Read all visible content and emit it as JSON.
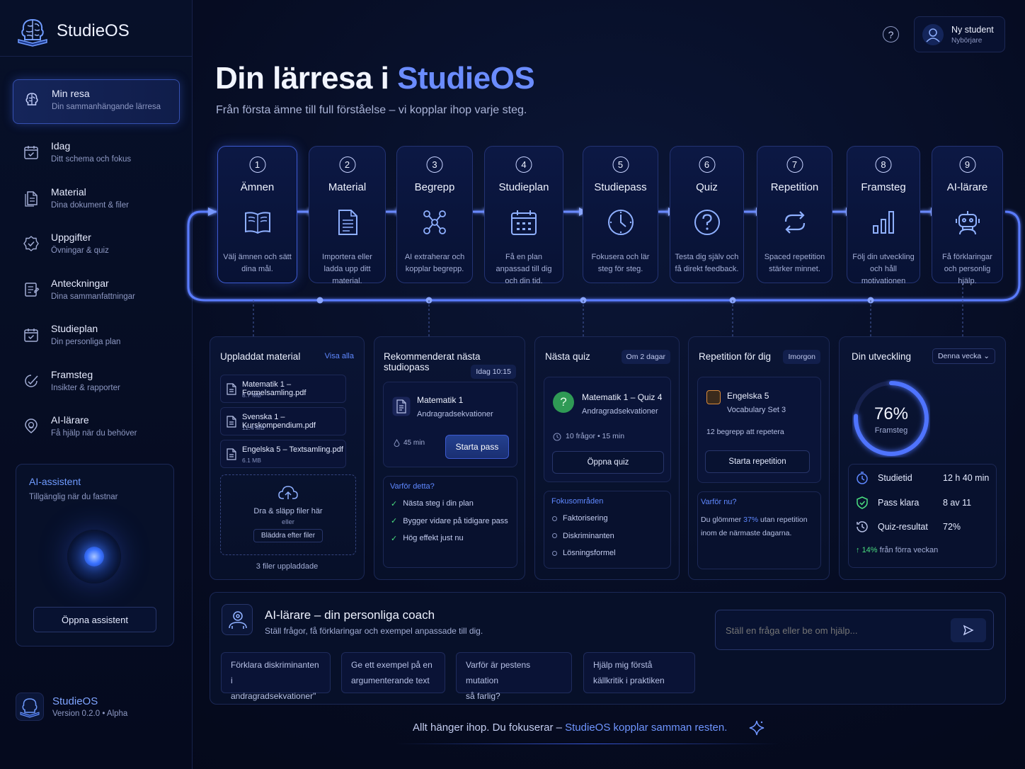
{
  "app": {
    "name": "StudieOS",
    "version": "Version 0.2.0 • Alpha"
  },
  "user": {
    "name": "Ny student",
    "level": "Nybörjare"
  },
  "sidebar": {
    "items": [
      {
        "label": "Min resa",
        "sub": "Din sammanhängande lärresa",
        "icon": "brain-icon",
        "active": true
      },
      {
        "label": "Idag",
        "sub": "Ditt schema och fokus",
        "icon": "calendar-check-icon"
      },
      {
        "label": "Material",
        "sub": "Dina dokument & filer",
        "icon": "documents-icon"
      },
      {
        "label": "Uppgifter",
        "sub": "Övningar & quiz",
        "icon": "badge-check-icon"
      },
      {
        "label": "Anteckningar",
        "sub": "Dina sammanfattningar",
        "icon": "notes-icon"
      },
      {
        "label": "Studieplan",
        "sub": "Din personliga plan",
        "icon": "calendar-icon"
      },
      {
        "label": "Framsteg",
        "sub": "Insikter & rapporter",
        "icon": "progress-icon"
      },
      {
        "label": "AI-lärare",
        "sub": "Få hjälp när du behöver",
        "icon": "ai-tutor-icon"
      }
    ],
    "assistant": {
      "title": "AI-assistent",
      "subtitle": "Tillgänglig när du fastnar",
      "button": "Öppna assistent"
    }
  },
  "header": {
    "title_main": "Din lärresa i ",
    "title_accent": "StudieOS",
    "subtitle": "Från första ämne till full förståelse – vi kopplar ihop varje steg."
  },
  "steps": [
    {
      "num": "1",
      "title": "Ämnen",
      "desc": "Välj ämnen och sätt dina mål.",
      "icon": "book-icon"
    },
    {
      "num": "2",
      "title": "Material",
      "desc": "Importera eller ladda upp ditt material.",
      "icon": "document-icon"
    },
    {
      "num": "3",
      "title": "Begrepp",
      "desc": "AI extraherar och kopplar begrepp.",
      "icon": "network-icon"
    },
    {
      "num": "4",
      "title": "Studieplan",
      "desc": "Få en plan anpassad till dig och din tid.",
      "icon": "calendar-icon"
    },
    {
      "num": "5",
      "title": "Studiepass",
      "desc": "Fokusera och lär steg för steg.",
      "icon": "clock-icon"
    },
    {
      "num": "6",
      "title": "Quiz",
      "desc": "Testa dig själv och få direkt feedback.",
      "icon": "question-icon"
    },
    {
      "num": "7",
      "title": "Repetition",
      "desc": "Spaced repetition stärker minnet.",
      "icon": "repeat-icon"
    },
    {
      "num": "8",
      "title": "Framsteg",
      "desc": "Följ din utveckling och håll motivationen",
      "icon": "bar-chart-icon"
    },
    {
      "num": "9",
      "title": "AI-lärare",
      "desc": "Få förklaringar och personlig hjälp.",
      "icon": "robot-icon"
    }
  ],
  "uploaded": {
    "title": "Uppladdat material",
    "view_all": "Visa alla",
    "files": [
      {
        "name": "Matematik 1 – Formelsamling.pdf",
        "size": "8.7 MB"
      },
      {
        "name": "Svenska 1 – Kurskompendium.pdf",
        "size": "12.4 MB"
      },
      {
        "name": "Engelska 5 – Textsamling.pdf",
        "size": "6.1 MB"
      }
    ],
    "drop_text": "Dra & släpp filer här",
    "or": "eller",
    "browse": "Bläddra efter filer",
    "count": "3 filer uppladdade"
  },
  "next_session": {
    "title": "Rekommenderat nästa studiopass",
    "time_chip": "Idag 10:15",
    "subject": "Matematik 1",
    "topic": "Andragradsekvationer",
    "duration": "45 min",
    "button": "Starta pass",
    "why_title": "Varför detta?",
    "reasons": [
      "Nästa steg i din plan",
      "Bygger vidare på tidigare pass",
      "Hög effekt just nu"
    ]
  },
  "next_quiz": {
    "title": "Nästa quiz",
    "chip": "Om 2 dagar",
    "name": "Matematik 1 – Quiz 4",
    "topic": "Andragradsekvationer",
    "meta": "10 frågor • 15 min",
    "button": "Öppna quiz",
    "focus_title": "Fokusområden",
    "focus": [
      "Faktorisering",
      "Diskriminanten",
      "Lösningsformel"
    ]
  },
  "repetition": {
    "title": "Repetition för dig",
    "chip": "Imorgon",
    "subject": "Engelska 5",
    "set": "Vocabulary Set 3",
    "count": "12 begrepp att repetera",
    "button": "Starta repetition",
    "why_title": "Varför nu?",
    "why_pre": "Du glömmer ",
    "why_pct": "37%",
    "why_post": " utan repetition inom de närmaste dagarna."
  },
  "progress": {
    "title": "Din utveckling",
    "period": "Denna vecka",
    "value": 76,
    "value_label": "76%",
    "label": "Framsteg",
    "stats": [
      {
        "label": "Studietid",
        "value": "12 h 40 min",
        "icon": "timer-icon"
      },
      {
        "label": "Pass klara",
        "value": "8 av 11",
        "icon": "shield-check-icon"
      },
      {
        "label": "Quiz-resultat",
        "value": "72%",
        "icon": "history-icon"
      }
    ],
    "trend_pct": "14%",
    "trend_text": " från förra veckan"
  },
  "coach": {
    "title": "AI-lärare – din personliga coach",
    "subtitle": "Ställ frågor, få förklaringar och exempel anpassade till dig.",
    "placeholder": "Ställ en fråga eller be om hjälp...",
    "suggestions": [
      {
        "l1": "Förklara diskriminanten i",
        "l2": "andragradsekvationer\""
      },
      {
        "l1": "Ge ett exempel på en",
        "l2": "argumenterande text"
      },
      {
        "l1": "Varför är pestens mutation",
        "l2": "så farlig?"
      },
      {
        "l1": "Hjälp mig förstå",
        "l2": "källkritik i praktiken"
      }
    ]
  },
  "footer": {
    "pre": "Allt hänger ihop. Du fokuserar – ",
    "accent": "StudieOS kopplar samman resten."
  },
  "colors": {
    "accent": "#6b8cff",
    "background": "#060c22",
    "card": "#0a1434",
    "success": "#4ade80"
  }
}
